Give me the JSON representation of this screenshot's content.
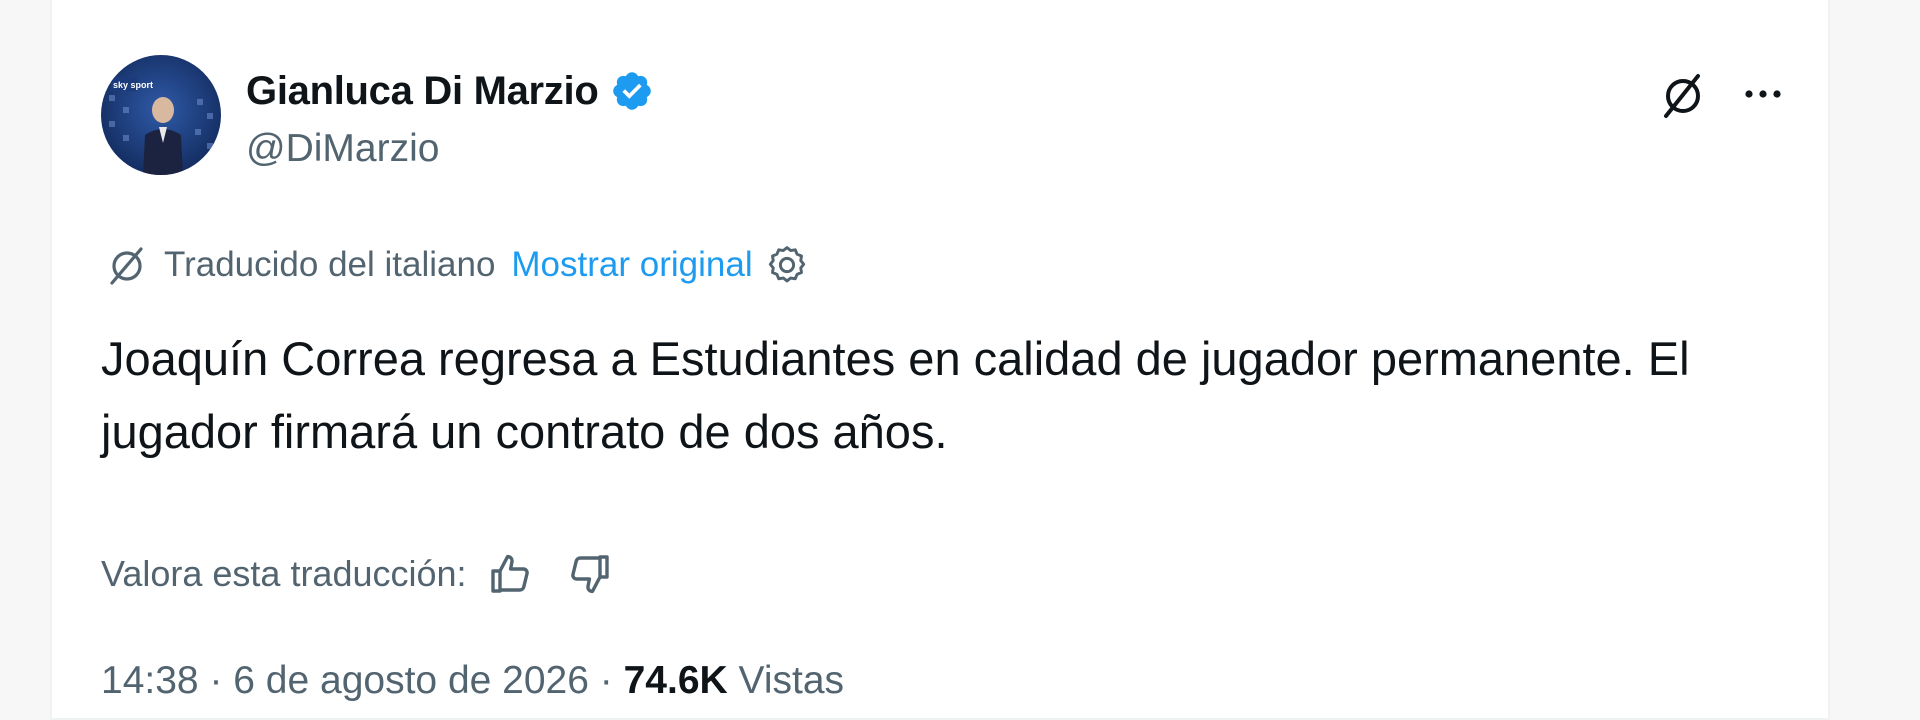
{
  "author": {
    "display_name": "Gianluca Di Marzio",
    "handle": "@DiMarzio",
    "verified": true,
    "avatar_logo_text": "sky sport"
  },
  "translation": {
    "label": "Traducido del italiano",
    "show_original": "Mostrar original"
  },
  "tweet": {
    "text": "Joaquín Correa regresa a Estudiantes en calidad de jugador permanente. El jugador firmará un contrato de dos años."
  },
  "rating": {
    "label": "Valora esta traducción:"
  },
  "meta": {
    "time": "14:38",
    "separator": " · ",
    "date": "6 de agosto de 2026",
    "views_count": "74.6K",
    "views_label": "Vistas"
  },
  "colors": {
    "accent": "#1d9bf0",
    "text_primary": "#0f1419",
    "text_secondary": "#536471"
  },
  "icons": {
    "verified": "verified-badge-icon",
    "grok": "grok-icon",
    "more": "more-options-icon",
    "translate": "translate-icon",
    "settings": "settings-gear-icon",
    "thumbs_up": "thumbs-up-icon",
    "thumbs_down": "thumbs-down-icon"
  }
}
